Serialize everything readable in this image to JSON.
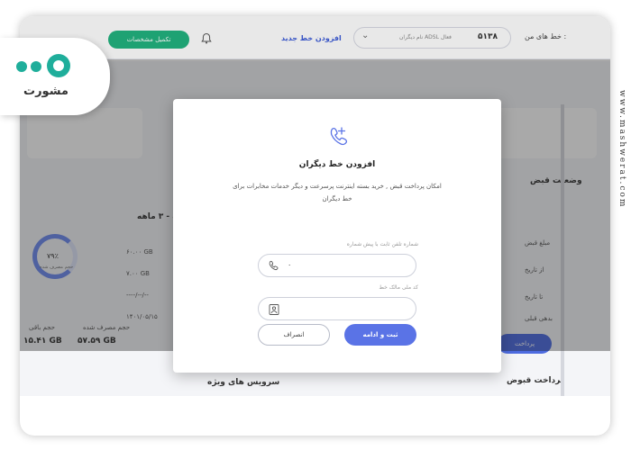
{
  "watermark": "www.mashwerat.com",
  "logo": {
    "text": "مشورت"
  },
  "app_header": {
    "complete_button": "تکمیل مشخصات",
    "add_line": "افزودن خط جدید",
    "line_select": {
      "meta": "نام دیگران  ADSL  فعال",
      "number": "۵۱۳۸"
    },
    "my_lines_label": "خط های من :"
  },
  "background": {
    "status_title": "وضعیت قبض",
    "plan_title": "گیگ - ۳ ماهه",
    "values": [
      "۶۰.۰۰ GB",
      "۷.۰۰ GB",
      "----/--/--",
      "۱۴۰۱/۰۵/۱۵"
    ],
    "ring_value": "۷۹٪",
    "ring_label": "حجم مصرف شده",
    "legend_used": "حجم مصرف شده",
    "legend_remain": "حجم باقی",
    "used_value": "۵۷.۵۹ GB",
    "remain_value": "۱۵.۴۱ GB",
    "row_labels": [
      "مبلغ قبض",
      "از تاریخ",
      "تا تاریخ",
      "بدهی قبلی"
    ],
    "pay_button": "پرداخت",
    "special_services": "سرویس های ویژه",
    "bill_payment": "پرداخت قبوض"
  },
  "modal": {
    "title": "افزودن خط دیگران",
    "description": "امکان پرداخت قبض , خرید بسته اینترنت پرسرعت و دیگر خدمات مخابرات برای خط دیگران",
    "phone_label": "شماره تلفن ثابت با پیش شماره",
    "phone_value": "۰",
    "owner_label": "کد ملی مالک خط",
    "owner_value": "",
    "submit_label": "ثبت و ادامه",
    "cancel_label": "انصراف",
    "colors": {
      "primary": "#5a73e6",
      "accent": "#1fb27d"
    }
  }
}
